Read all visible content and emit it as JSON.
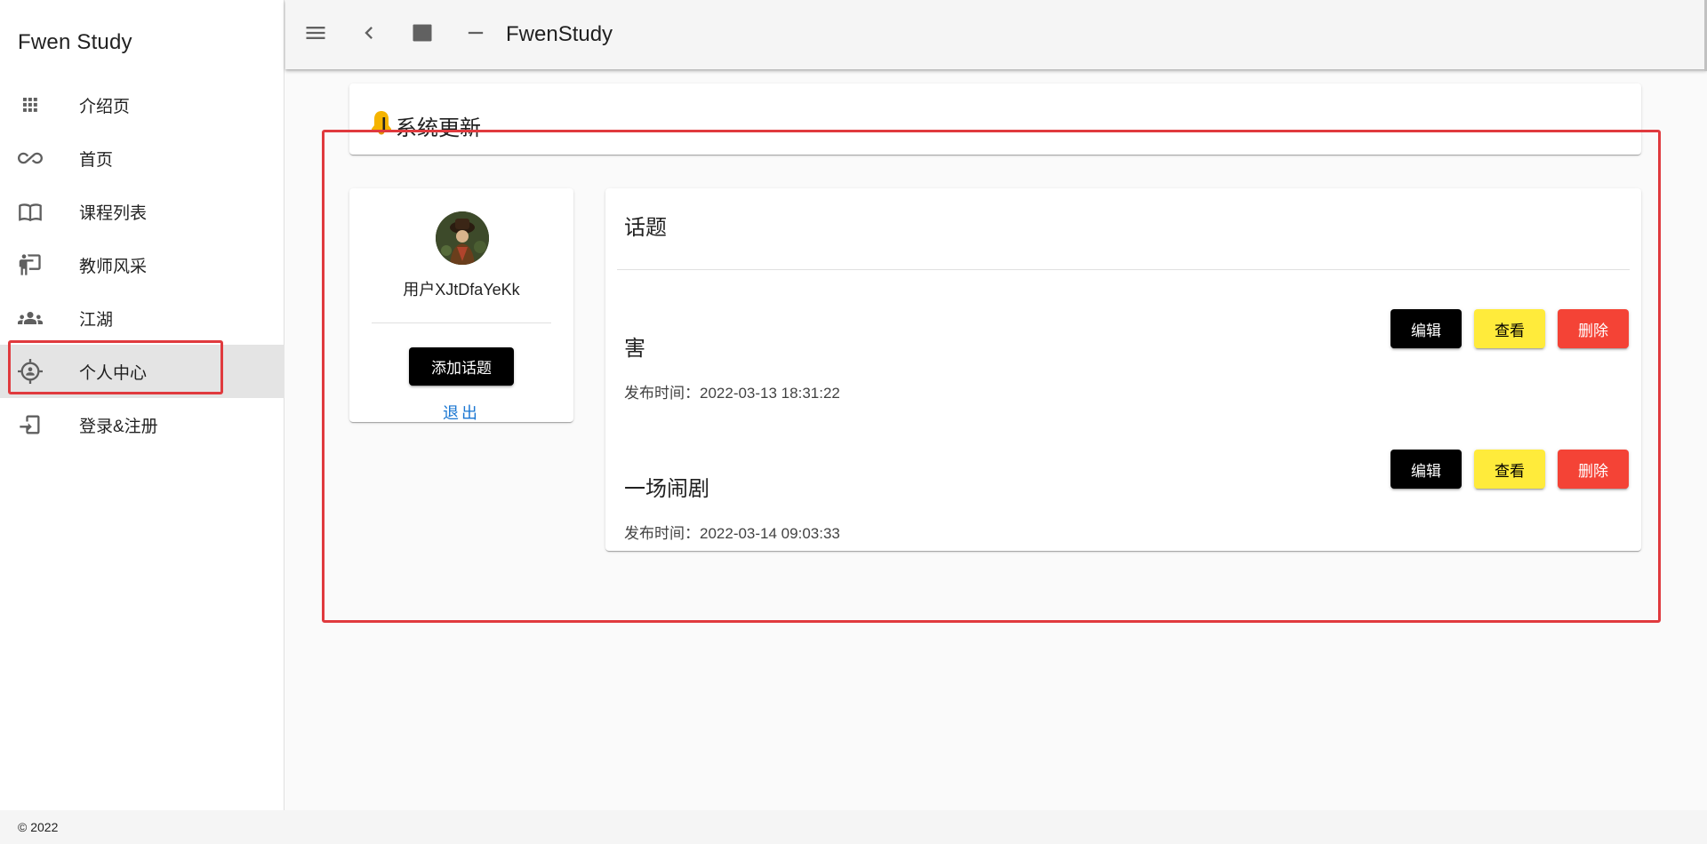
{
  "app": {
    "brand": "Fwen Study",
    "title": "FwenStudy",
    "footer": "© 2022"
  },
  "sidebar": {
    "items": [
      {
        "label": "介绍页",
        "icon": "apps-grid-icon"
      },
      {
        "label": "首页",
        "icon": "infinity-icon"
      },
      {
        "label": "课程列表",
        "icon": "book-open-icon"
      },
      {
        "label": "教师风采",
        "icon": "teacher-icon"
      },
      {
        "label": "江湖",
        "icon": "people-icon"
      },
      {
        "label": "个人中心",
        "icon": "account-target-icon",
        "active": true
      },
      {
        "label": "登录&注册",
        "icon": "login-icon"
      }
    ]
  },
  "topbar": {
    "icons": [
      "menu-icon",
      "chevron-left-icon",
      "window-icon",
      "minus-icon"
    ]
  },
  "update": {
    "title": "系统更新",
    "icon": "bell-icon"
  },
  "profile": {
    "username": "用户XJtDfaYeKk",
    "add_topic_label": "添加话题",
    "logout_label": "退出"
  },
  "topics": {
    "header": "话题",
    "buttons": {
      "edit": "编辑",
      "view": "查看",
      "delete": "删除"
    },
    "items": [
      {
        "title": "害",
        "meta": "发布时间：2022-03-13 18:31:22"
      },
      {
        "title": "一场闹剧",
        "meta": "发布时间：2022-03-14 09:03:33"
      }
    ]
  },
  "colors": {
    "edit": "#000000",
    "view": "#ffeb3b",
    "delete": "#f44336",
    "link": "#1976d2",
    "annotation": "#e03a3e"
  }
}
